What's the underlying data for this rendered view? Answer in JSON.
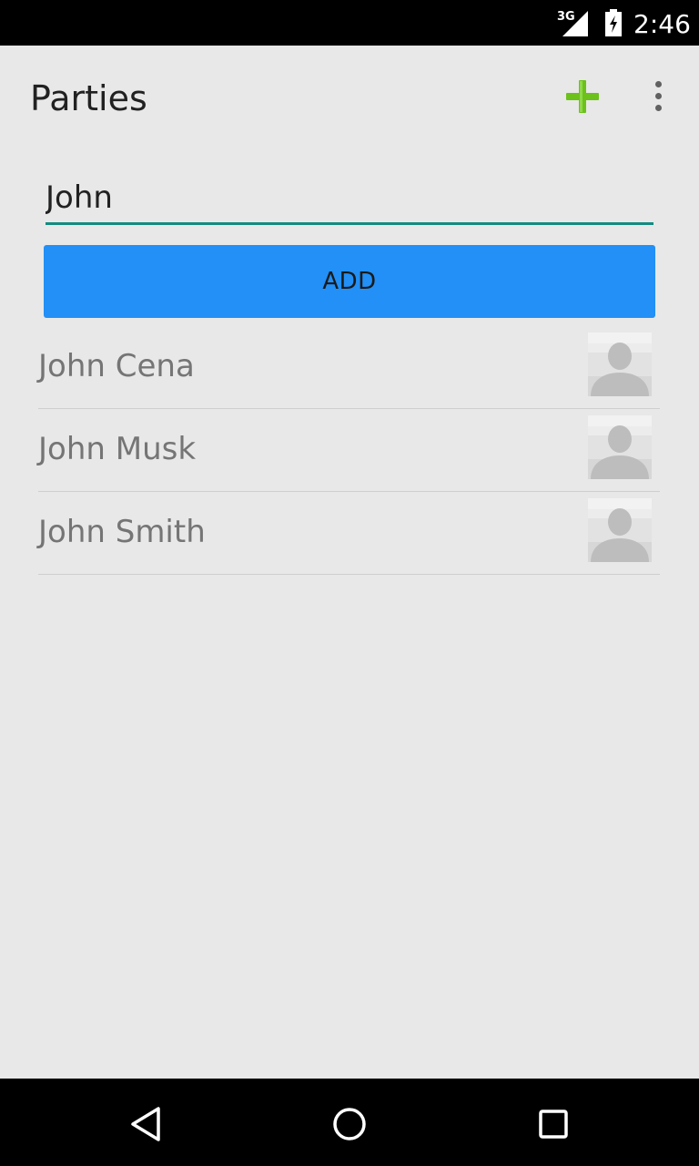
{
  "status_bar": {
    "network": "3G",
    "time": "2:46"
  },
  "toolbar": {
    "title": "Parties",
    "add_icon": "plus-icon",
    "overflow_icon": "more-vert-icon",
    "accent": "#6cc11a"
  },
  "form": {
    "name_value": "John",
    "add_label": "ADD",
    "button_color": "#2290f6",
    "underline_color": "#138b80"
  },
  "contacts": [
    {
      "name": "John Cena"
    },
    {
      "name": "John Musk"
    },
    {
      "name": "John Smith"
    }
  ],
  "nav": {
    "back_icon": "back-icon",
    "home_icon": "home-icon",
    "recents_icon": "recents-icon"
  }
}
